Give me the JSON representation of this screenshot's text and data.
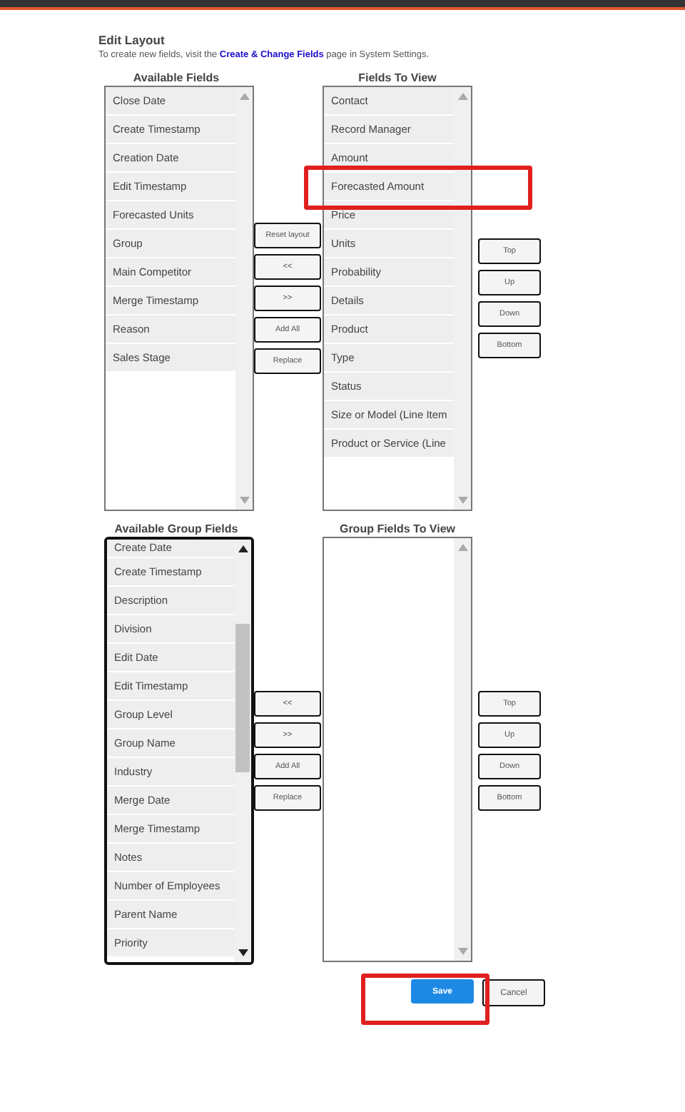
{
  "heading": {
    "title": "Edit Layout",
    "note": "To create new fields, visit the **Create & Change Fields** page in System Settings."
  },
  "sections": [
    {
      "available": {
        "title": "Available Fields",
        "focused": false,
        "scrolled": false,
        "items": [
          "Close Date",
          "Create Timestamp",
          "Creation Date",
          "Edit Timestamp",
          "Forecasted Units",
          "Group",
          "Main Competitor",
          "Merge Timestamp",
          "Reason",
          "Sales Stage"
        ]
      },
      "move_buttons": [
        "Reset layout",
        "<<",
        ">>",
        "Add All",
        "Replace"
      ],
      "chosen": {
        "title": "Fields To View",
        "focused": false,
        "scrolled": false,
        "items": [
          {
            "label": "Contact",
            "highlighted": false
          },
          {
            "label": "Record Manager",
            "highlighted": false
          },
          {
            "label": "Amount",
            "highlighted": false
          },
          {
            "label": "Forecasted Amount",
            "highlighted": true
          },
          {
            "label": "Price",
            "highlighted": false
          },
          {
            "label": "Units",
            "highlighted": false
          },
          {
            "label": "Probability",
            "highlighted": false
          },
          {
            "label": "Details",
            "highlighted": false
          },
          {
            "label": "Product",
            "highlighted": false
          },
          {
            "label": "Type",
            "highlighted": false
          },
          {
            "label": "Status",
            "highlighted": false
          },
          {
            "label": "Size or Model (Line Item",
            "highlighted": false
          },
          {
            "label": "Product or Service (Line",
            "highlighted": false
          }
        ]
      },
      "order_buttons": [
        "Top",
        "Up",
        "Down",
        "Bottom"
      ]
    },
    {
      "available": {
        "title": "Available Group Fields",
        "focused": true,
        "scrolled": true,
        "items": [
          "Create Date",
          "Create Timestamp",
          "Description",
          "Division",
          "Edit Date",
          "Edit Timestamp",
          "Group Level",
          "Group Name",
          "Industry",
          "Merge Date",
          "Merge Timestamp",
          "Notes",
          "Number of Employees",
          "Parent Name",
          "Priority"
        ]
      },
      "move_buttons": [
        "<<",
        ">>",
        "Add All",
        "Replace"
      ],
      "chosen": {
        "title": "Group Fields To View",
        "focused": false,
        "scrolled": false
      },
      "order_buttons": [
        "Top",
        "Up",
        "Down",
        "Bottom"
      ]
    }
  ],
  "footer": {
    "save": "Save",
    "cancel": "Cancel",
    "save_highlighted": true
  }
}
